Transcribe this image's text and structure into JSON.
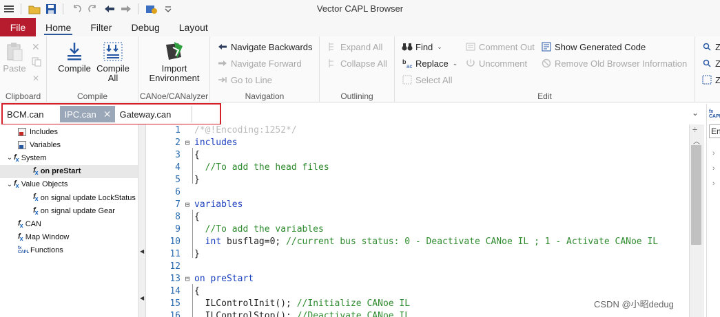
{
  "window": {
    "title": "Vector CAPL Browser"
  },
  "menu": {
    "file": "File",
    "tabs": [
      "Home",
      "Filter",
      "Debug",
      "Layout"
    ]
  },
  "ribbon": {
    "clipboard": {
      "label": "Clipboard",
      "paste": "Paste"
    },
    "compile": {
      "label": "Compile",
      "compile": "Compile",
      "compile_all_1": "Compile",
      "compile_all_2": "All"
    },
    "canoe": {
      "label": "CANoe/CANalyzer",
      "import_1": "Import",
      "import_2": "Environment"
    },
    "navigation": {
      "label": "Navigation",
      "back": "Navigate Backwards",
      "forward": "Navigate Forward",
      "goto": "Go to Line"
    },
    "outlining": {
      "label": "Outlining",
      "expand": "Expand All",
      "collapse": "Collapse All"
    },
    "edit": {
      "label": "Edit",
      "find": "Find",
      "replace": "Replace",
      "select_all": "Select All",
      "comment_out": "Comment Out",
      "uncomment": "Uncomment",
      "show_generated": "Show Generated Code",
      "remove_old": "Remove Old Browser Information"
    },
    "partial_right": [
      "Z",
      "Z",
      "Z"
    ]
  },
  "doc_tabs": [
    {
      "label": "BCM.can",
      "active": false
    },
    {
      "label": "IPC.can",
      "active": true
    },
    {
      "label": "Gateway.can",
      "active": false
    }
  ],
  "tree": [
    {
      "label": "Includes",
      "icon": "includes-icon",
      "level": 1,
      "caret": ""
    },
    {
      "label": "Variables",
      "icon": "variables-icon",
      "level": 1,
      "caret": ""
    },
    {
      "label": "System",
      "icon": "fx-icon",
      "level": 0,
      "caret": "v"
    },
    {
      "label": "on preStart",
      "icon": "fx-icon",
      "level": 2,
      "caret": "",
      "selected": true
    },
    {
      "label": "Value Objects",
      "icon": "fx-icon",
      "level": 0,
      "caret": "v"
    },
    {
      "label": "on signal update LockStatus",
      "icon": "fx-icon",
      "level": 2,
      "caret": ""
    },
    {
      "label": "on signal update Gear",
      "icon": "fx-icon",
      "level": 2,
      "caret": ""
    },
    {
      "label": "CAN",
      "icon": "fx-icon",
      "level": 1,
      "caret": ""
    },
    {
      "label": "Map Window",
      "icon": "fx-icon",
      "level": 1,
      "caret": ""
    },
    {
      "label": "Functions",
      "icon": "capl-icon",
      "level": 1,
      "caret": ""
    }
  ],
  "code_lines": [
    {
      "n": "1",
      "fold": "",
      "parts": [
        [
          "pp",
          "/*@!Encoding:1252*/"
        ]
      ]
    },
    {
      "n": "2",
      "fold": "⊟",
      "parts": [
        [
          "kw",
          "includes"
        ]
      ]
    },
    {
      "n": "3",
      "fold": "",
      "parts": [
        [
          "",
          "{"
        ]
      ]
    },
    {
      "n": "4",
      "fold": "",
      "parts": [
        [
          "cm",
          "  //To add the head files"
        ]
      ]
    },
    {
      "n": "5",
      "fold": "",
      "parts": [
        [
          "",
          "}"
        ]
      ]
    },
    {
      "n": "6",
      "fold": "",
      "parts": [
        [
          "",
          ""
        ]
      ]
    },
    {
      "n": "7",
      "fold": "⊟",
      "parts": [
        [
          "kw",
          "variables"
        ]
      ]
    },
    {
      "n": "8",
      "fold": "",
      "parts": [
        [
          "",
          "{"
        ]
      ]
    },
    {
      "n": "9",
      "fold": "",
      "parts": [
        [
          "cm",
          "  //To add the variables"
        ]
      ]
    },
    {
      "n": "10",
      "fold": "",
      "parts": [
        [
          "kw",
          "  int"
        ],
        [
          "",
          " busflag=0; "
        ],
        [
          "cm",
          "//current bus status: 0 - Deactivate CANoe IL ; 1 - Activate CANoe IL"
        ]
      ]
    },
    {
      "n": "11",
      "fold": "",
      "parts": [
        [
          "",
          "}"
        ]
      ]
    },
    {
      "n": "12",
      "fold": "",
      "parts": [
        [
          "",
          ""
        ]
      ]
    },
    {
      "n": "13",
      "fold": "⊟",
      "parts": [
        [
          "kw",
          "on preStart"
        ]
      ]
    },
    {
      "n": "14",
      "fold": "",
      "parts": [
        [
          "",
          "{"
        ]
      ]
    },
    {
      "n": "15",
      "fold": "",
      "parts": [
        [
          "",
          "  ILControlInit(); "
        ],
        [
          "cm",
          "//Initialize CANoe IL"
        ]
      ]
    },
    {
      "n": "16",
      "fold": "",
      "parts": [
        [
          "",
          "  ILControlStop(); "
        ],
        [
          "cm",
          "//Deactivate CANoe IL"
        ]
      ]
    }
  ],
  "right_panel": {
    "en_text": "En",
    "icon": "capl-icon"
  },
  "watermark": "CSDN @小昭dedug"
}
